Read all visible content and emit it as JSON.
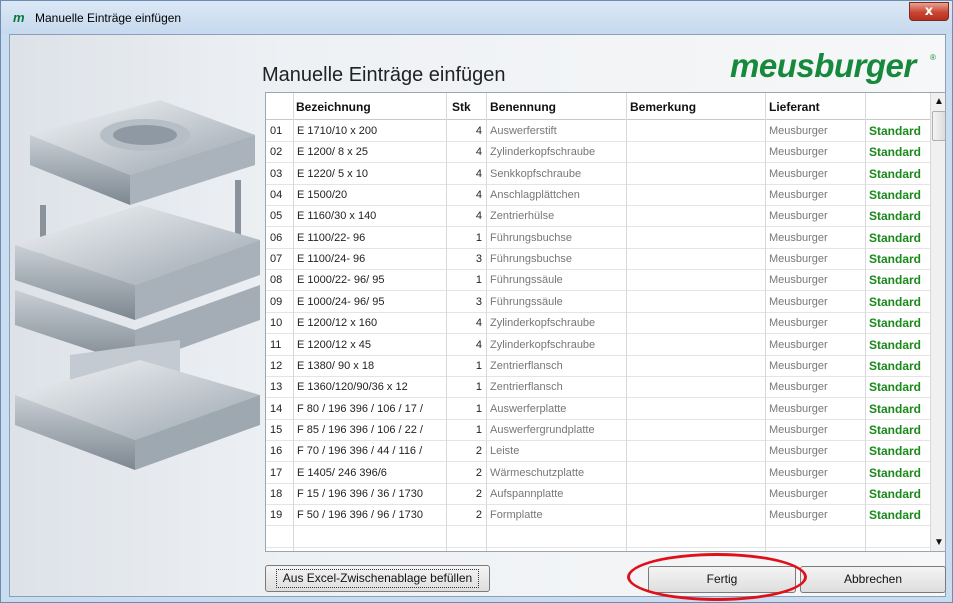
{
  "window": {
    "title": "Manuelle Einträge einfügen",
    "close_label": "x"
  },
  "heading": "Manuelle Einträge einfügen",
  "logo": {
    "text": "meusburger",
    "mark": "®"
  },
  "table": {
    "columns": [
      "Bezeichnung",
      "Stk",
      "Benennung",
      "Bemerkung",
      "Lieferant",
      ""
    ],
    "rows": [
      [
        "01",
        "E 1710/10    x 200",
        "4",
        "Auswerferstift",
        "",
        "Meusburger",
        "Standard"
      ],
      [
        "02",
        "E 1200/  8 x   25",
        "4",
        "Zylinderkopfschraube",
        "",
        "Meusburger",
        "Standard"
      ],
      [
        "03",
        "E 1220/  5   x  10",
        "4",
        "Senkkopfschraube",
        "",
        "Meusburger",
        "Standard"
      ],
      [
        "04",
        "E 1500/20",
        "4",
        "Anschlagplättchen",
        "",
        "Meusburger",
        "Standard"
      ],
      [
        "05",
        "E 1160/30 x 140",
        "4",
        "Zentrierhülse",
        "",
        "Meusburger",
        "Standard"
      ],
      [
        "06",
        "E 1100/22-  96",
        "1",
        "Führungsbuchse",
        "",
        "Meusburger",
        "Standard"
      ],
      [
        "07",
        "E 1100/24-  96",
        "3",
        "Führungsbuchse",
        "",
        "Meusburger",
        "Standard"
      ],
      [
        "08",
        "E 1000/22-  96/  95",
        "1",
        "Führungssäule",
        "",
        "Meusburger",
        "Standard"
      ],
      [
        "09",
        "E 1000/24-  96/  95",
        "3",
        "Führungssäule",
        "",
        "Meusburger",
        "Standard"
      ],
      [
        "10",
        "E 1200/12 x 160",
        "4",
        "Zylinderkopfschraube",
        "",
        "Meusburger",
        "Standard"
      ],
      [
        "11",
        "E 1200/12 x   45",
        "4",
        "Zylinderkopfschraube",
        "",
        "Meusburger",
        "Standard"
      ],
      [
        "12",
        "E 1380/  90 x 18",
        "1",
        "Zentrierflansch",
        "",
        "Meusburger",
        "Standard"
      ],
      [
        "13",
        "E 1360/120/90/36 x 12",
        "1",
        "Zentrierflansch",
        "",
        "Meusburger",
        "Standard"
      ],
      [
        "14",
        "F 80 / 196  396 / 106 / 17 /",
        "1",
        "Auswerferplatte",
        "",
        "Meusburger",
        "Standard"
      ],
      [
        "15",
        "F 85 / 196  396 / 106 / 22 /",
        "1",
        "Auswerfergrundplatte",
        "",
        "Meusburger",
        "Standard"
      ],
      [
        "16",
        "F 70 / 196  396 / 44 / 116 /",
        "2",
        "Leiste",
        "",
        "Meusburger",
        "Standard"
      ],
      [
        "17",
        "E 1405/  246   396/6",
        "2",
        "Wärmeschutzplatte",
        "",
        "Meusburger",
        "Standard"
      ],
      [
        "18",
        "F 15 / 196  396 / 36 / 1730",
        "2",
        "Aufspannplatte",
        "",
        "Meusburger",
        "Standard"
      ],
      [
        "19",
        "F 50 / 196  396 / 96 / 1730",
        "2",
        "Formplatte",
        "",
        "Meusburger",
        "Standard"
      ]
    ]
  },
  "scrollbar": {
    "up": "▲",
    "down": "▼"
  },
  "buttons": {
    "excel": "Aus Excel-Zwischenablage befüllen",
    "fertig": "Fertig",
    "abbrechen": "Abbrechen"
  },
  "colors": {
    "standard": "#1a8a1a",
    "logo": "#17893d",
    "highlight": "#e0101a"
  }
}
